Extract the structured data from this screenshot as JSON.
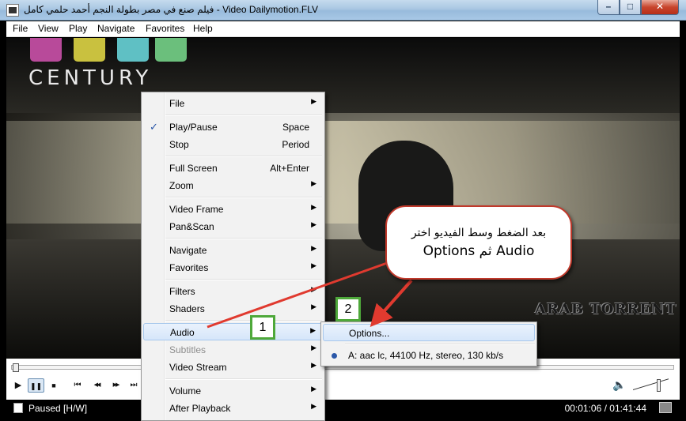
{
  "window": {
    "title": "فيلم صنع في مصر بطولة النجم أحمد حلمي كامل - Video Dailymotion.FLV",
    "buttons": {
      "minimize": "–",
      "maximize": "□",
      "close": "✕"
    }
  },
  "menubar": [
    "File",
    "View",
    "Play",
    "Navigate",
    "Favorites",
    "Help"
  ],
  "video": {
    "logo_text": "CENTURY",
    "logo_colors": [
      "#b84a9a",
      "#c9c13f",
      "#5fc0c4",
      "#6bbf7c"
    ],
    "watermark": "ARAB TORRENT"
  },
  "controls": {
    "play": "▶",
    "pause": "❚❚",
    "stop": "■",
    "prev": "⏮",
    "rewind": "◀◀",
    "forward": "▶▶",
    "next": "⏭",
    "volume_icon": "speaker-icon",
    "seek_position": 0.0,
    "volume_level": 0.75
  },
  "status": {
    "text": "Paused [H/W]",
    "time": "00:01:06 / 01:41:44"
  },
  "context_menu": {
    "items": [
      {
        "label": "File",
        "shortcut": "",
        "submenu": true,
        "checked": false,
        "disabled": false
      },
      {
        "label": "Play/Pause",
        "shortcut": "Space",
        "submenu": false,
        "checked": true,
        "disabled": false
      },
      {
        "label": "Stop",
        "shortcut": "Period",
        "submenu": false,
        "checked": false,
        "disabled": false
      },
      {
        "label": "Full Screen",
        "shortcut": "Alt+Enter",
        "submenu": false,
        "checked": false,
        "disabled": false
      },
      {
        "label": "Zoom",
        "shortcut": "",
        "submenu": true,
        "checked": false,
        "disabled": false
      },
      {
        "label": "Video Frame",
        "shortcut": "",
        "submenu": true,
        "checked": false,
        "disabled": false
      },
      {
        "label": "Pan&Scan",
        "shortcut": "",
        "submenu": true,
        "checked": false,
        "disabled": false
      },
      {
        "label": "Navigate",
        "shortcut": "",
        "submenu": true,
        "checked": false,
        "disabled": false
      },
      {
        "label": "Favorites",
        "shortcut": "",
        "submenu": true,
        "checked": false,
        "disabled": false
      },
      {
        "label": "Filters",
        "shortcut": "",
        "submenu": true,
        "checked": false,
        "disabled": false
      },
      {
        "label": "Shaders",
        "shortcut": "",
        "submenu": true,
        "checked": false,
        "disabled": false
      },
      {
        "label": "Audio",
        "shortcut": "",
        "submenu": true,
        "checked": false,
        "disabled": false,
        "highlighted": true
      },
      {
        "label": "Subtitles",
        "shortcut": "",
        "submenu": true,
        "checked": false,
        "disabled": true
      },
      {
        "label": "Video Stream",
        "shortcut": "",
        "submenu": true,
        "checked": false,
        "disabled": false
      },
      {
        "label": "Volume",
        "shortcut": "",
        "submenu": true,
        "checked": false,
        "disabled": false
      },
      {
        "label": "After Playback",
        "shortcut": "",
        "submenu": true,
        "checked": false,
        "disabled": false
      }
    ],
    "check_mark": "✓",
    "arrow": "▶"
  },
  "audio_submenu": {
    "options_label": "Options...",
    "track_label": "A: aac lc, 44100 Hz, stereo, 130 kb/s"
  },
  "annotation": {
    "line1": "بعد الضغط وسط الفيديو اختر",
    "line2": "Audio ثم Options",
    "badge1": "1",
    "badge2": "2",
    "border_color": "#c0392b",
    "arrow_color": "#e03a2f",
    "badge_color": "#4ea83a"
  }
}
